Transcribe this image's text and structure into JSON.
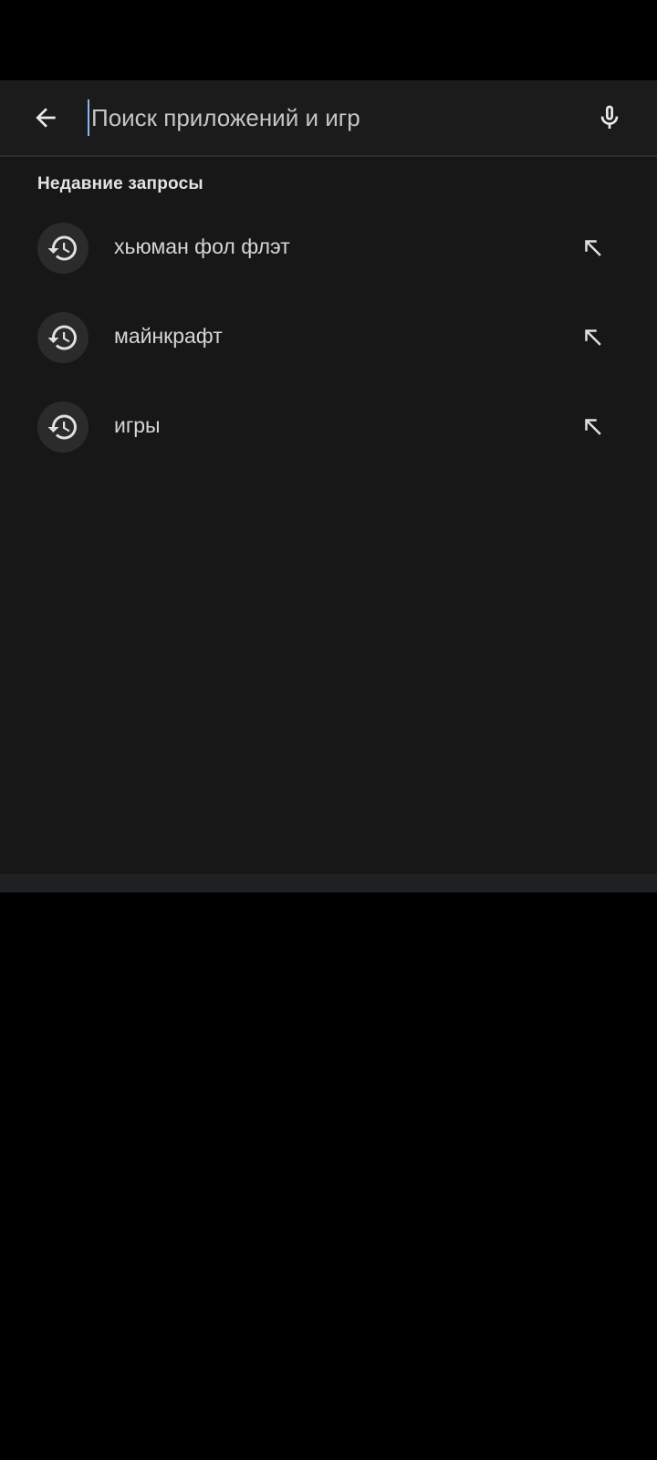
{
  "search": {
    "placeholder": "Поиск приложений и игр",
    "value": "",
    "back_icon": "arrow-left-icon",
    "mic_icon": "microphone-icon"
  },
  "recent": {
    "title": "Недавние запросы",
    "item_icon": "history-icon",
    "fill_icon": "arrow-up-left-icon",
    "items": [
      {
        "label": "хьюман фол флэт"
      },
      {
        "label": "майнкрафт"
      },
      {
        "label": "игры"
      }
    ]
  },
  "colors": {
    "background": "#000000",
    "sheet": "#171717",
    "search_bar": "#1b1b1b",
    "icon_circle": "#2b2b2b",
    "text_primary": "#e3e3e3",
    "caret": "#8ab4f8"
  }
}
